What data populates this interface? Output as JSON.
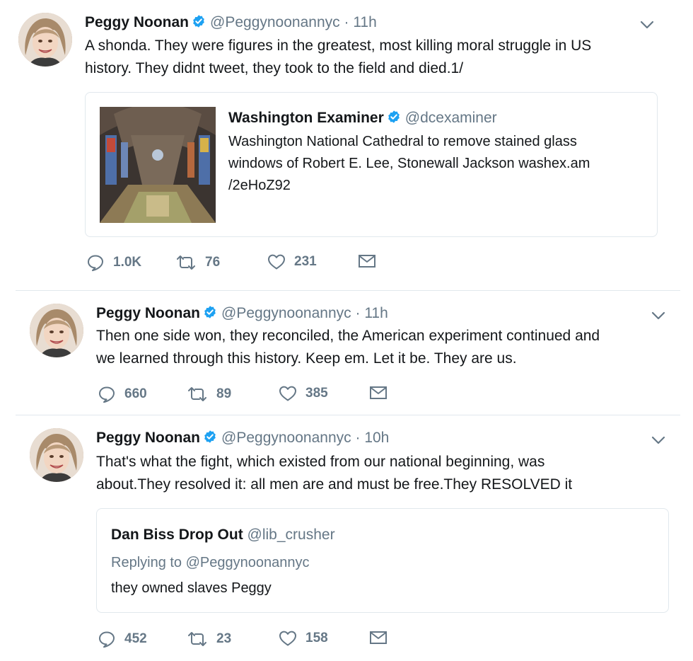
{
  "tweets": [
    {
      "author_name": "Peggy Noonan",
      "handle": "@Peggynoonannyc",
      "time": "11h",
      "text": "A shonda. They were figures in the greatest, most killing moral struggle in US\nhistory. They didnt tweet, they took to the field and died.1/",
      "quoted": {
        "author_name": "Washington Examiner",
        "handle": "@dcexaminer",
        "text": "Washington National Cathedral to remove stained glass\nwindows of Robert E. Lee, Stonewall Jackson washex.am\n/2eHoZ92"
      },
      "replies": "1.0K",
      "retweets": "76",
      "likes": "231"
    },
    {
      "author_name": "Peggy Noonan",
      "handle": "@Peggynoonannyc",
      "time": "11h",
      "text": "Then one side won, they reconciled, the American experiment continued and\nwe learned through this history. Keep em. Let it be. They are us.",
      "replies": "660",
      "retweets": "89",
      "likes": "385"
    },
    {
      "author_name": "Peggy Noonan",
      "handle": "@Peggynoonannyc",
      "time": "10h",
      "text": "That's what the fight, which existed from our national beginning, was\nabout.They resolved it: all men are and must be free.They RESOLVED it",
      "quoted": {
        "author_name": "Dan Biss Drop Out",
        "handle": "@lib_crusher",
        "replying_to": "Replying to @Peggynoonannyc",
        "text": "they owned slaves Peggy"
      },
      "replies": "452",
      "retweets": "23",
      "likes": "158"
    }
  ],
  "separator": " · ",
  "icons": {
    "verified": "verified-badge-icon",
    "reply": "reply-icon",
    "retweet": "retweet-icon",
    "like": "heart-icon",
    "dm": "envelope-icon",
    "more": "chevron-down-icon"
  },
  "colors": {
    "verified": "#1da1f2",
    "secondary_text": "#657786",
    "border": "#e1e8ed"
  }
}
